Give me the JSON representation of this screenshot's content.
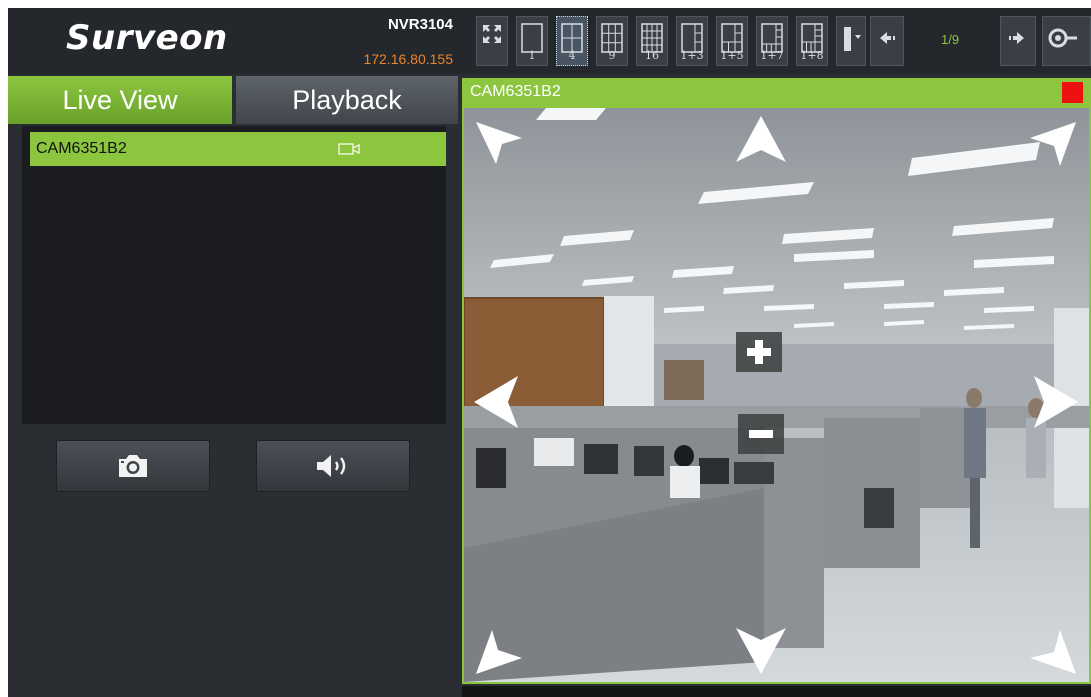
{
  "header": {
    "logo_text": "Surveon",
    "nvr_name": "NVR3104",
    "nvr_ip": "172.16.80.155",
    "page_indicator": "1/9",
    "layouts": [
      {
        "label": "",
        "icon": "fullscreen-icon"
      },
      {
        "label": "1",
        "icon": "layout-1-icon"
      },
      {
        "label": "4",
        "icon": "layout-4-icon",
        "selected": true
      },
      {
        "label": "9",
        "icon": "layout-9-icon"
      },
      {
        "label": "16",
        "icon": "layout-16-icon"
      },
      {
        "label": "1+3",
        "icon": "layout-1-3-icon"
      },
      {
        "label": "1+5",
        "icon": "layout-1-5-icon"
      },
      {
        "label": "1+7",
        "icon": "layout-1-7-icon"
      },
      {
        "label": "1+8",
        "icon": "layout-1-8-icon"
      }
    ]
  },
  "tabs": {
    "live": "Live View",
    "playback": "Playback"
  },
  "camera_list": [
    {
      "name": "CAM6351B2",
      "icon": "camera-icon"
    }
  ],
  "controls": {
    "snapshot_icon": "camera-snapshot-icon",
    "audio_icon": "speaker-icon"
  },
  "viewer": {
    "title": "CAM6351B2",
    "status_color": "#ee1111"
  },
  "colors": {
    "accent": "#8cc63f",
    "ip_text": "#e8862a",
    "panel_bg": "#2a2e33"
  }
}
